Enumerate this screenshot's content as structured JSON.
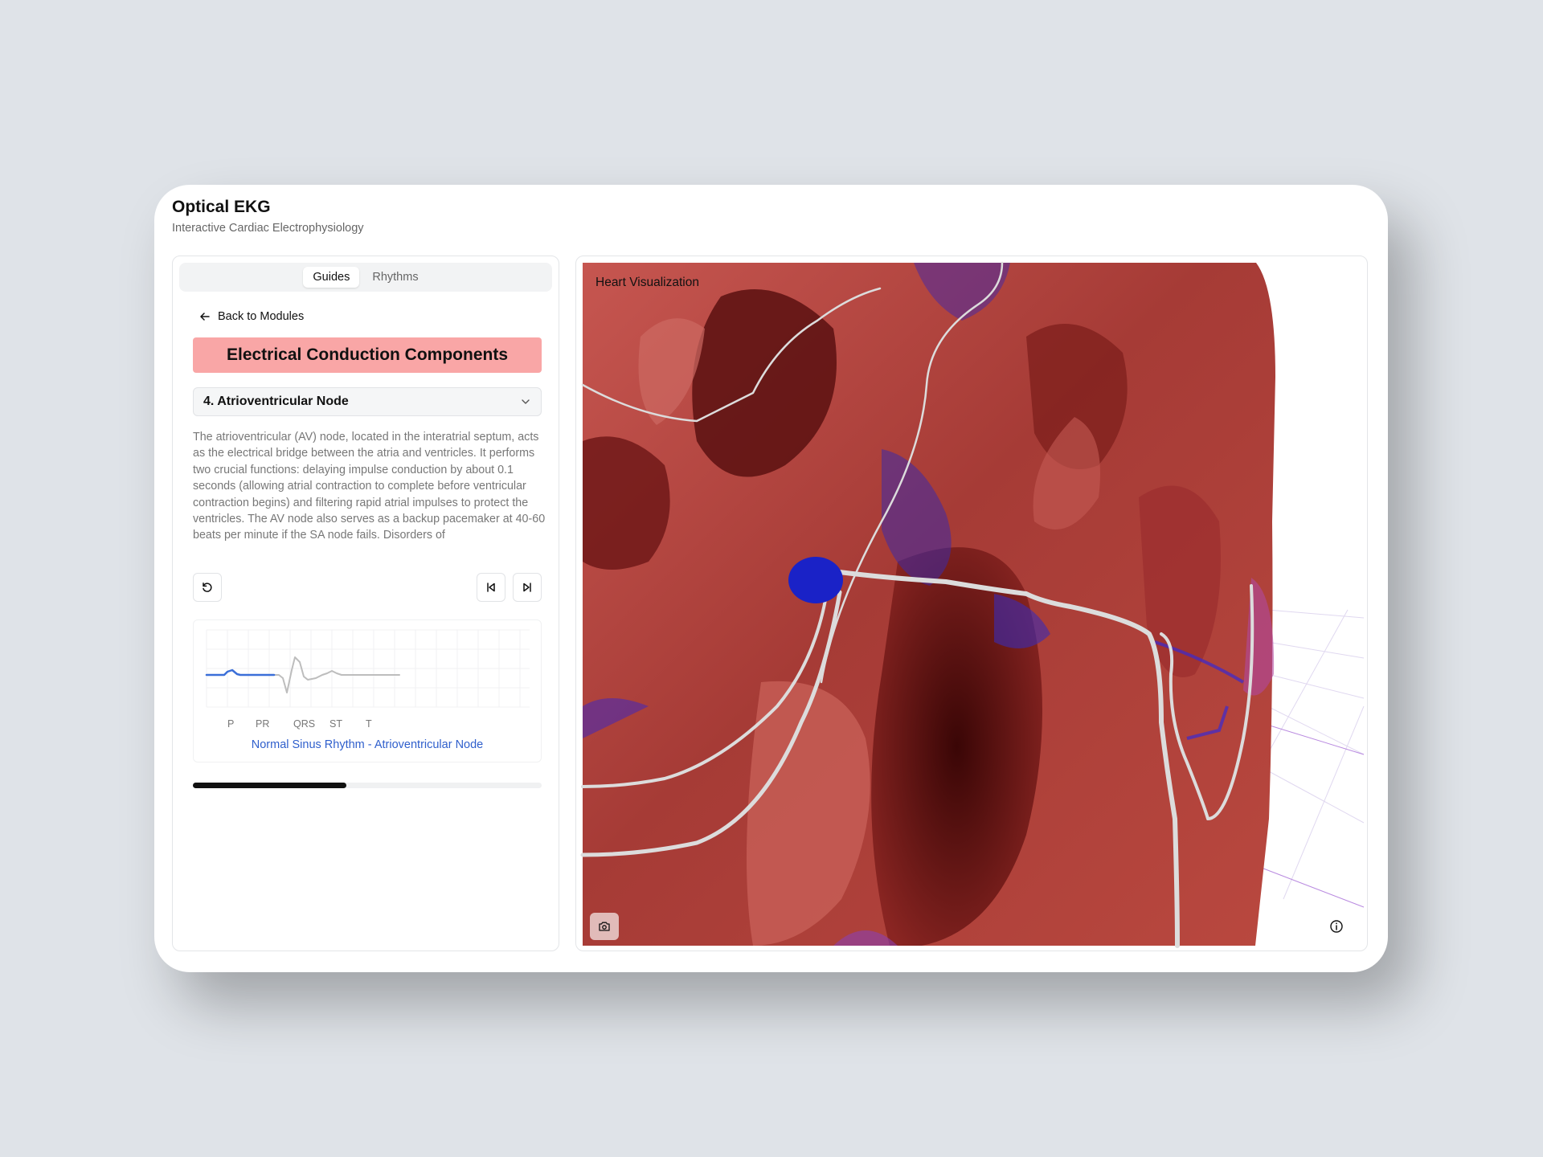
{
  "app": {
    "title": "Optical EKG",
    "subtitle": "Interactive Cardiac Electrophysiology"
  },
  "tabs": [
    {
      "label": "Guides",
      "active": true
    },
    {
      "label": "Rhythms",
      "active": false
    }
  ],
  "guide": {
    "back_label": "Back to Modules",
    "module_title": "Electrical Conduction Components",
    "section_selected": "4. Atrioventricular Node",
    "description": "The atrioventricular (AV) node, located in the interatrial septum, acts as the electrical bridge between the atria and ventricles. It performs two crucial functions: delaying impulse conduction by about 0.1 seconds (allowing atrial contraction to complete before ventricular contraction begins) and filtering rapid atrial impulses to protect the ventricles. The AV node also serves as a backup pacemaker at 40-60 beats per minute if the SA node fails. Disorders of",
    "progress_fraction": 0.44
  },
  "icons": {
    "back": "arrow-left-icon",
    "select": "chevron-down-icon",
    "reset": "rotate-ccw-icon",
    "prev": "skip-back-icon",
    "next": "skip-forward-icon",
    "camera": "camera-icon",
    "info": "info-icon"
  },
  "ekg": {
    "wave_labels": [
      "P",
      "PR",
      "QRS",
      "ST",
      "T"
    ],
    "caption": "Normal Sinus Rhythm - Atrioventricular Node",
    "highlight_color": "#3b6fd8",
    "trace_color": "#bdbdbd"
  },
  "visualization": {
    "label": "Heart Visualization",
    "tissue_color": "#b84a45",
    "node_color": "#1a22c7",
    "pathway_color": "#dcdcdc"
  }
}
